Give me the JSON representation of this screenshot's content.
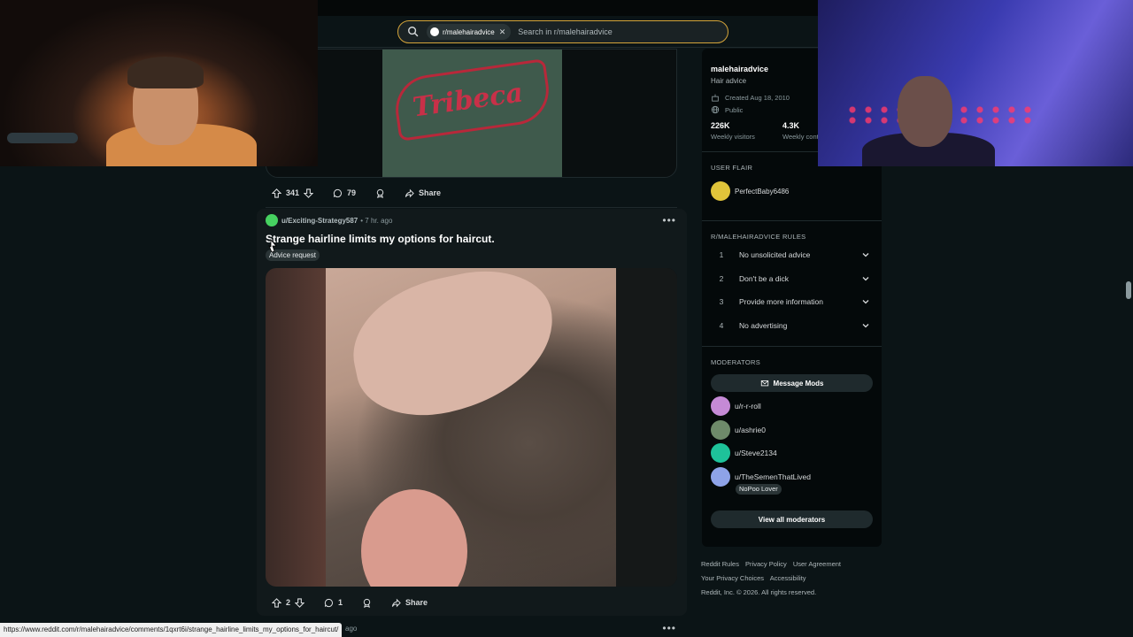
{
  "search": {
    "community_chip": "r/malehairadvice",
    "placeholder": "Search in r/malehairadvice"
  },
  "post1": {
    "votes": "341",
    "comments": "79",
    "share_label": "Share"
  },
  "post2": {
    "author": "u/Exciting-Strategy587",
    "age": "• 7 hr. ago",
    "title": "Strange hairline limits my options for haircut.",
    "flair": "Advice request",
    "votes": "2",
    "comments": "1",
    "share_label": "Share"
  },
  "post3": {
    "age": "ago"
  },
  "sidebar": {
    "name": "malehairadvice",
    "description": "Hair advice",
    "created": "Created Aug 18, 2010",
    "visibility": "Public",
    "stats": [
      {
        "value": "226K",
        "label": "Weekly visitors"
      },
      {
        "value": "4.3K",
        "label": "Weekly contributions"
      }
    ],
    "user_flair_heading": "USER FLAIR",
    "user_flair_name": "PerfectBaby6486",
    "rules_heading": "R/MALEHAIRADVICE RULES",
    "rules": [
      {
        "num": "1",
        "text": "No unsolicited advice"
      },
      {
        "num": "2",
        "text": "Don't be a dick"
      },
      {
        "num": "3",
        "text": "Provide more information"
      },
      {
        "num": "4",
        "text": "No advertising"
      }
    ],
    "moderators_heading": "MODERATORS",
    "message_mods": "Message Mods",
    "moderators": [
      {
        "name": "u/r-r-roll",
        "color": "#c58ad6"
      },
      {
        "name": "u/ashrie0",
        "color": "#6e8a6a"
      },
      {
        "name": "u/Steve2134",
        "color": "#1ec29a"
      },
      {
        "name": "u/TheSemenThatLived",
        "color": "#8ea3e8"
      }
    ],
    "mod_flair": "NoPoo Lover",
    "view_all_mods": "View all moderators"
  },
  "footer": {
    "links": [
      "Reddit Rules",
      "Privacy Policy",
      "User Agreement",
      "Your Privacy Choices",
      "Accessibility"
    ],
    "copyright": "Reddit, Inc. © 2026. All rights reserved."
  },
  "status_url": "https://www.reddit.com/r/malehairadvice/comments/1qxrt6i/strange_hairline_limits_my_options_for_haircut/",
  "colors": {
    "background": "#0b1416",
    "search_border": "#d4a43a",
    "flair_bg": "#2a3436"
  }
}
